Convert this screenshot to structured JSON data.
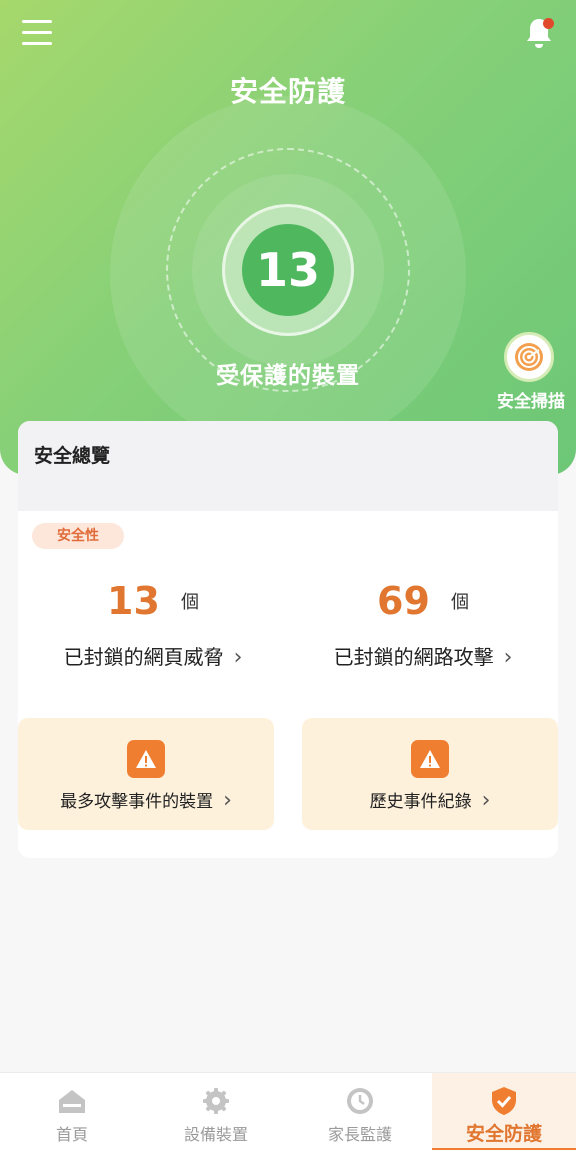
{
  "header": {
    "title": "安全防護"
  },
  "hero": {
    "device_count": "13",
    "subtitle": "受保護的裝置"
  },
  "scan": {
    "label": "安全掃描"
  },
  "overview": {
    "title": "安全總覽",
    "badge": "安全性",
    "stats": [
      {
        "value": "13",
        "unit": "個",
        "label": "已封鎖的網頁威脅"
      },
      {
        "value": "69",
        "unit": "個",
        "label": "已封鎖的網路攻擊"
      }
    ],
    "tiles": [
      {
        "label": "最多攻擊事件的裝置"
      },
      {
        "label": "歷史事件紀錄"
      }
    ]
  },
  "tabs": [
    {
      "label": "首頁",
      "icon": "home-icon"
    },
    {
      "label": "設備裝置",
      "icon": "gear-icon"
    },
    {
      "label": "家長監護",
      "icon": "clock-icon"
    },
    {
      "label": "安全防護",
      "icon": "shield-check-icon",
      "active": true
    }
  ],
  "colors": {
    "accent": "#e0762f",
    "hero_green": "#86d078",
    "alert": "#e04a2a"
  }
}
